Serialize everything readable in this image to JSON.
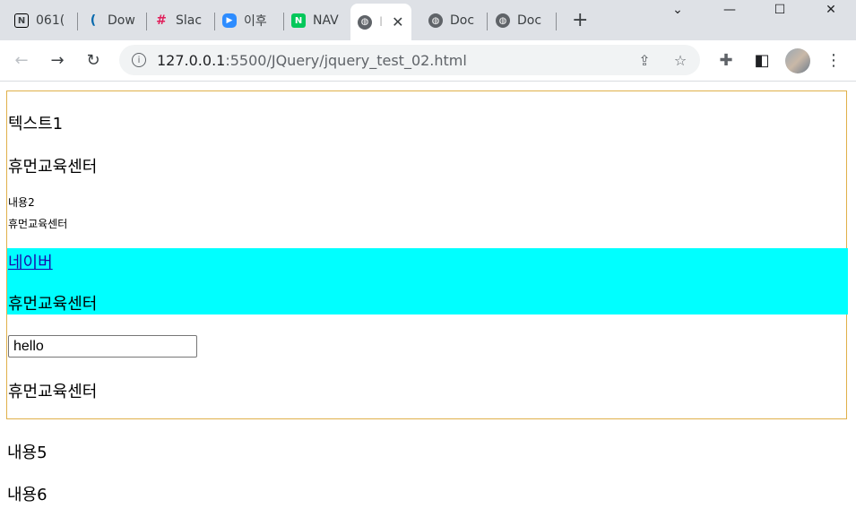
{
  "browser": {
    "tabs": [
      {
        "title": "061(",
        "favicon": "notion-icon"
      },
      {
        "title": "Dow",
        "favicon": "jquery-icon"
      },
      {
        "title": "Slac",
        "favicon": "slack-icon"
      },
      {
        "title": "이후",
        "favicon": "zoom-icon"
      },
      {
        "title": "NAV",
        "favicon": "naver-icon"
      },
      {
        "title": "I",
        "favicon": "globe-icon",
        "active": true
      },
      {
        "title": "Doc",
        "favicon": "globe-icon"
      },
      {
        "title": "Doc",
        "favicon": "globe-icon"
      }
    ],
    "url_host": "127.0.0.1",
    "url_path": ":5500/JQuery/jquery_test_02.html"
  },
  "content": {
    "text1": "텍스트1",
    "center1": "휴먼교육센터",
    "small1": "내용2",
    "small2": "휴먼교육센터",
    "link": "네이버",
    "center2": "휴먼교육센터",
    "input_value": "hello",
    "center3": "휴먼교육센터",
    "after1": "내용5",
    "after2": "내용6"
  },
  "colors": {
    "highlight": "#00ffff",
    "box_border": "#e0b04a"
  }
}
